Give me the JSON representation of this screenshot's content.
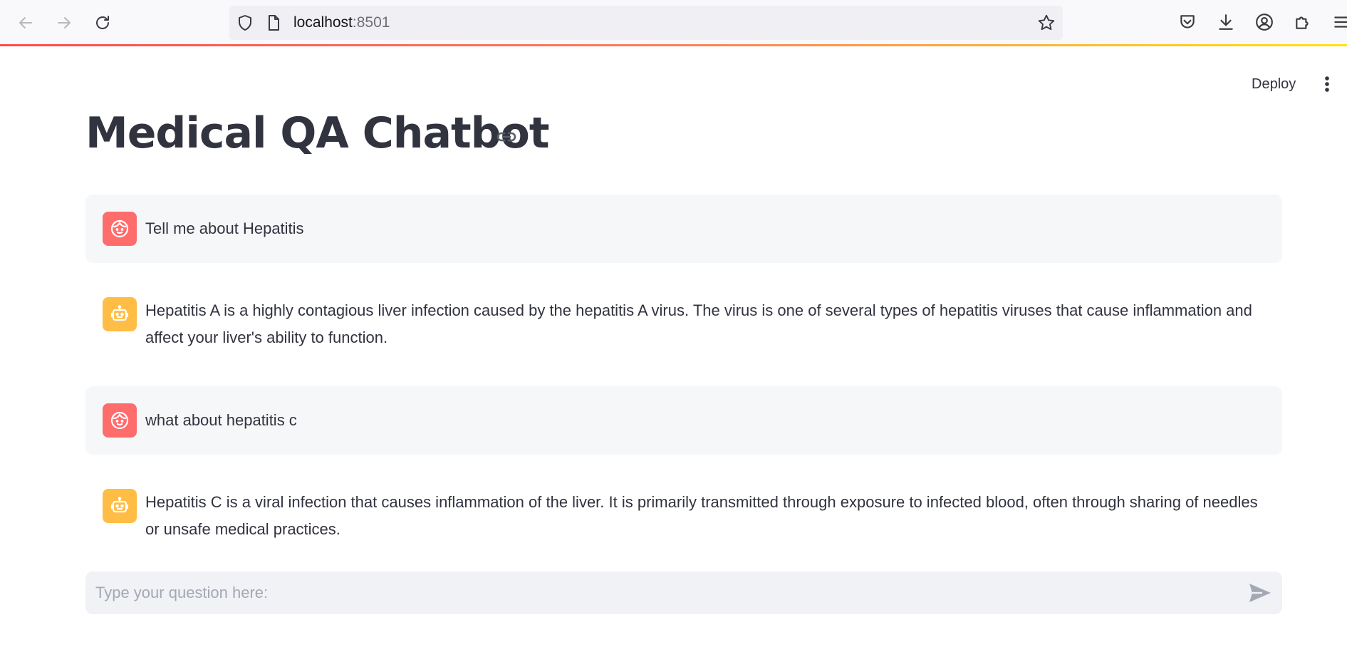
{
  "browser": {
    "url_host": "localhost",
    "url_port": ":8501"
  },
  "app": {
    "deploy_label": "Deploy",
    "title": "Medical QA Chatbot"
  },
  "messages": [
    {
      "role": "user",
      "text": "Tell me about Hepatitis"
    },
    {
      "role": "assistant",
      "text": "Hepatitis A is a highly contagious liver infection caused by the hepatitis A virus. The virus is one of several types of hepatitis viruses that cause inflammation and affect your liver's ability to function."
    },
    {
      "role": "user",
      "text": "what about hepatitis c"
    },
    {
      "role": "assistant",
      "text": "Hepatitis C is a viral infection that causes inflammation of the liver. It is primarily transmitted through exposure to infected blood, often through sharing of needles or unsafe medical practices."
    }
  ],
  "chat_input": {
    "placeholder": "Type your question here:",
    "value": ""
  },
  "colors": {
    "user_avatar": "#ff6c6c",
    "bot_avatar": "#ffbd45",
    "accent_gradient_start": "#ff4b4b",
    "accent_gradient_end": "#ffe312"
  },
  "icons": {
    "back": "arrow-left-icon",
    "forward": "arrow-right-icon",
    "reload": "reload-icon",
    "user_avatar": "face-icon",
    "bot_avatar": "robot-icon",
    "send": "send-icon"
  }
}
